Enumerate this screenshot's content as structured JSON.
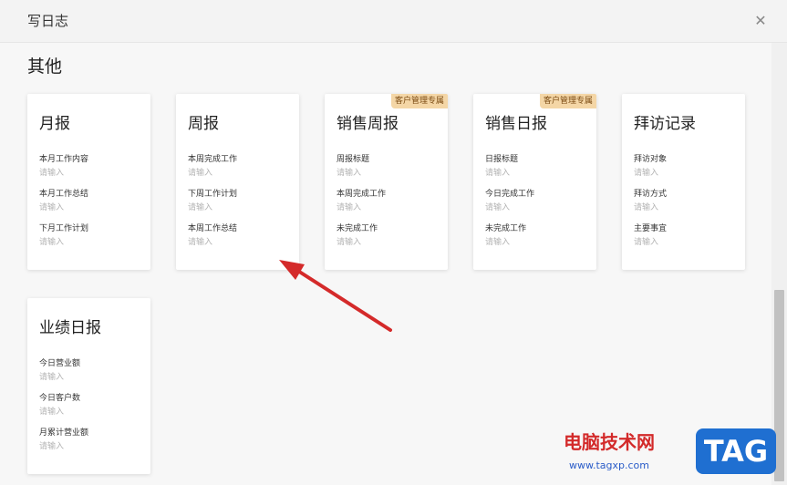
{
  "dialog": {
    "title": "写日志",
    "close_icon": "close-icon"
  },
  "section": {
    "title": "其他"
  },
  "templates": [
    {
      "title": "月报",
      "badge": "",
      "fields": [
        {
          "label": "本月工作内容",
          "placeholder": "请输入"
        },
        {
          "label": "本月工作总结",
          "placeholder": "请输入"
        },
        {
          "label": "下月工作计划",
          "placeholder": "请输入"
        }
      ]
    },
    {
      "title": "周报",
      "badge": "",
      "fields": [
        {
          "label": "本周完成工作",
          "placeholder": "请输入"
        },
        {
          "label": "下周工作计划",
          "placeholder": "请输入"
        },
        {
          "label": "本周工作总结",
          "placeholder": "请输入"
        }
      ]
    },
    {
      "title": "销售周报",
      "badge": "客户管理专属",
      "fields": [
        {
          "label": "周报标题",
          "placeholder": "请输入"
        },
        {
          "label": "本周完成工作",
          "placeholder": "请输入"
        },
        {
          "label": "未完成工作",
          "placeholder": "请输入"
        }
      ]
    },
    {
      "title": "销售日报",
      "badge": "客户管理专属",
      "fields": [
        {
          "label": "日报标题",
          "placeholder": "请输入"
        },
        {
          "label": "今日完成工作",
          "placeholder": "请输入"
        },
        {
          "label": "未完成工作",
          "placeholder": "请输入"
        }
      ]
    },
    {
      "title": "拜访记录",
      "badge": "",
      "fields": [
        {
          "label": "拜访对象",
          "placeholder": "请输入"
        },
        {
          "label": "拜访方式",
          "placeholder": "请输入"
        },
        {
          "label": "主要事宜",
          "placeholder": "请输入"
        }
      ]
    },
    {
      "title": "业绩日报",
      "badge": "",
      "fields": [
        {
          "label": "今日营业额",
          "placeholder": "请输入"
        },
        {
          "label": "今日客户数",
          "placeholder": "请输入"
        },
        {
          "label": "月累计营业额",
          "placeholder": "请输入"
        }
      ]
    }
  ],
  "annotation": {
    "arrow_color": "#d42a2a"
  },
  "watermark": {
    "site_name": "电脑技术网",
    "url": "www.tagxp.com",
    "tag": "TAG"
  }
}
